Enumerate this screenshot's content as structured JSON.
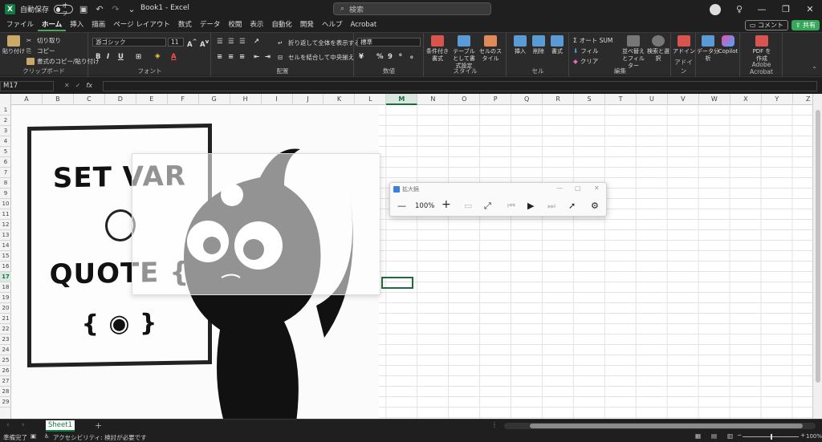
{
  "titlebar": {
    "autosave_label": "自動保存",
    "autosave_state": "オフ",
    "doc_title": "Book1 - Excel",
    "search_placeholder": "検索"
  },
  "menu": {
    "items": [
      "ファイル",
      "ホーム",
      "挿入",
      "描画",
      "ページ レイアウト",
      "数式",
      "データ",
      "校閲",
      "表示",
      "自動化",
      "開発",
      "ヘルプ",
      "Acrobat"
    ],
    "active": "ホーム",
    "comment_label": "コメント",
    "share_label": "共有"
  },
  "ribbon": {
    "clipboard": {
      "paste": "貼り付け",
      "cut": "切り取り",
      "copy": "コピー",
      "format_painter": "書式のコピー/貼り付け",
      "label": "クリップボード"
    },
    "font": {
      "name": "游ゴシック",
      "size": "11",
      "label": "フォント"
    },
    "alignment": {
      "wrap": "折り返して全体を表示する",
      "merge": "セルを結合して中央揃え",
      "label": "配置"
    },
    "number": {
      "format": "標準",
      "label": "数値"
    },
    "styles": {
      "conditional": "条件付き書式",
      "table": "テーブルとして書式設定",
      "cell": "セルのスタイル",
      "label": "スタイル"
    },
    "cells": {
      "insert": "挿入",
      "delete": "削除",
      "format": "書式",
      "label": "セル"
    },
    "editing": {
      "autosum": "オート SUM",
      "fill": "フィル",
      "clear": "クリア",
      "sort": "並べ替えとフィルター",
      "find": "検索と選択",
      "label": "編集"
    },
    "addins": {
      "addin": "アドイン",
      "label": "アドイン"
    },
    "analysis": {
      "data": "データ分析",
      "copilot": "Copilot"
    },
    "acrobat": {
      "pdf": "PDF を作成",
      "label": "Adobe Acrobat"
    }
  },
  "formula_bar": {
    "name_box": "M17",
    "fx": "fx",
    "value": ""
  },
  "grid": {
    "columns": [
      "A",
      "B",
      "C",
      "D",
      "E",
      "F",
      "G",
      "H",
      "I",
      "J",
      "K",
      "L",
      "M",
      "N",
      "O",
      "P",
      "Q",
      "R",
      "S",
      "T",
      "U",
      "V",
      "W",
      "X",
      "Y",
      "Z"
    ],
    "rows": [
      "1",
      "2",
      "3",
      "4",
      "5",
      "6",
      "7",
      "8",
      "9",
      "10",
      "11",
      "12",
      "13",
      "14",
      "15",
      "16",
      "17",
      "18",
      "19",
      "20",
      "21",
      "22",
      "23",
      "24",
      "25",
      "26",
      "27",
      "28",
      "29"
    ],
    "selected_col": "M",
    "selected_row": "17"
  },
  "illustration": {
    "line1": "SET VAR",
    "line2": "QUOTE {",
    "line3": "{ ◉ }"
  },
  "magnifier": {
    "title": "拡大鏡",
    "zoom": "100%"
  },
  "sheets": {
    "tabs": [
      "Sheet1"
    ]
  },
  "status": {
    "ready": "準備完了",
    "accessibility": "アクセシビリティ: 検討が必要です",
    "zoom": "100%"
  }
}
